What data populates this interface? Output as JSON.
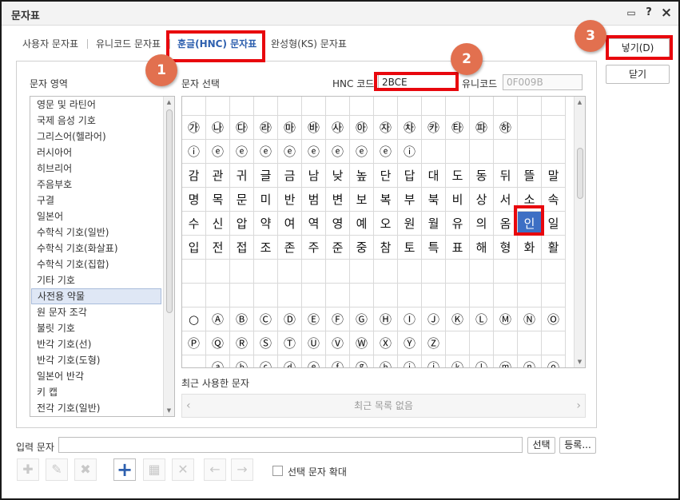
{
  "window": {
    "title": "문자표",
    "help": "?",
    "close": "×"
  },
  "tabs": [
    {
      "label": "사용자 문자표"
    },
    {
      "label": "유니코드 문자표"
    },
    {
      "label": "훈글(HNC) 문자표",
      "active": true
    },
    {
      "label": "완성형(KS) 문자표"
    }
  ],
  "labels": {
    "category_area": "문자 영역",
    "char_select": "문자 선택",
    "hnc_code": "HNC 코드",
    "unicode": "유니코드",
    "recent": "최근 사용한 문자",
    "recent_empty": "최근 목록 없음",
    "input_chars": "입력 문자",
    "enlarge": "선택 문자 확대"
  },
  "fields": {
    "hnc_code_value": "2BCE",
    "unicode_value": "0F009B",
    "input_value": ""
  },
  "buttons": {
    "insert": "넣기(D)",
    "close": "닫기",
    "select": "선택",
    "register": "등록..."
  },
  "categories": [
    "영문 및 라틴어",
    "국제 음성 기호",
    "그리스어(헬라어)",
    "러시아어",
    "히브리어",
    "주음부호",
    "구결",
    "일본어",
    "수학식 기호(일반)",
    "수학식 기호(화살표)",
    "수학식 기호(집합)",
    "기타 기호",
    "사전용 약물",
    "원 문자 조각",
    "불릿 기호",
    "반각 기호(선)",
    "반각 기호(도형)",
    "일본어 반각",
    "키 캡",
    "전각 기호(일반)"
  ],
  "selected_category": "사전용 약물",
  "char_rows": [
    [],
    [
      "㉮",
      "㉯",
      "㉰",
      "㉱",
      "㉲",
      "㉳",
      "㉴",
      "㉵",
      "㉶",
      "㉷",
      "㉸",
      "㉹",
      "㉺",
      "㉻"
    ],
    [
      "ⓘ",
      "ⓔ",
      "ⓔ",
      "ⓔ",
      "ⓔ",
      "ⓔ",
      "ⓔ",
      "ⓔ",
      "ⓔ",
      "ⓘ"
    ],
    [
      "감",
      "관",
      "귀",
      "글",
      "금",
      "남",
      "낮",
      "높",
      "단",
      "답",
      "대",
      "도",
      "동",
      "뒤",
      "뜰",
      "말"
    ],
    [
      "명",
      "목",
      "문",
      "미",
      "반",
      "범",
      "변",
      "보",
      "복",
      "부",
      "북",
      "비",
      "상",
      "서",
      "소",
      "속"
    ],
    [
      "수",
      "신",
      "압",
      "약",
      "여",
      "역",
      "영",
      "예",
      "오",
      "원",
      "월",
      "유",
      "의",
      "옴",
      "인",
      "일"
    ],
    [
      "입",
      "전",
      "접",
      "조",
      "존",
      "주",
      "준",
      "중",
      "참",
      "토",
      "특",
      "표",
      "해",
      "형",
      "화",
      "활"
    ],
    [],
    [],
    [
      "○",
      "Ⓐ",
      "Ⓑ",
      "Ⓒ",
      "Ⓓ",
      "Ⓔ",
      "Ⓕ",
      "Ⓖ",
      "Ⓗ",
      "Ⓘ",
      "Ⓙ",
      "Ⓚ",
      "Ⓛ",
      "Ⓜ",
      "Ⓝ",
      "Ⓞ"
    ],
    [
      "Ⓟ",
      "Ⓠ",
      "Ⓡ",
      "Ⓢ",
      "Ⓣ",
      "Ⓤ",
      "Ⓥ",
      "Ⓦ",
      "Ⓧ",
      "Ⓨ",
      "Ⓩ"
    ],
    [
      "",
      "ⓐ",
      "ⓑ",
      "ⓒ",
      "ⓓ",
      "ⓔ",
      "ⓕ",
      "ⓖ",
      "ⓗ",
      "ⓘ",
      "ⓙ",
      "ⓚ",
      "ⓛ",
      "ⓜ",
      "ⓝ",
      "ⓞ"
    ]
  ],
  "selected_char": "인",
  "badges": [
    "1",
    "2",
    "3"
  ],
  "toolbar_icons": [
    "add-sparkle-icon",
    "edit-sparkle-icon",
    "delete-sparkle-icon",
    "plus-icon",
    "table-add-icon",
    "delete-x-icon",
    "arrow-left-icon",
    "arrow-right-icon"
  ],
  "colors": {
    "accent": "#2d5fae",
    "highlight": "#e8070d",
    "badge": "#e2704f",
    "selected_cell": "#3d6fc4"
  }
}
